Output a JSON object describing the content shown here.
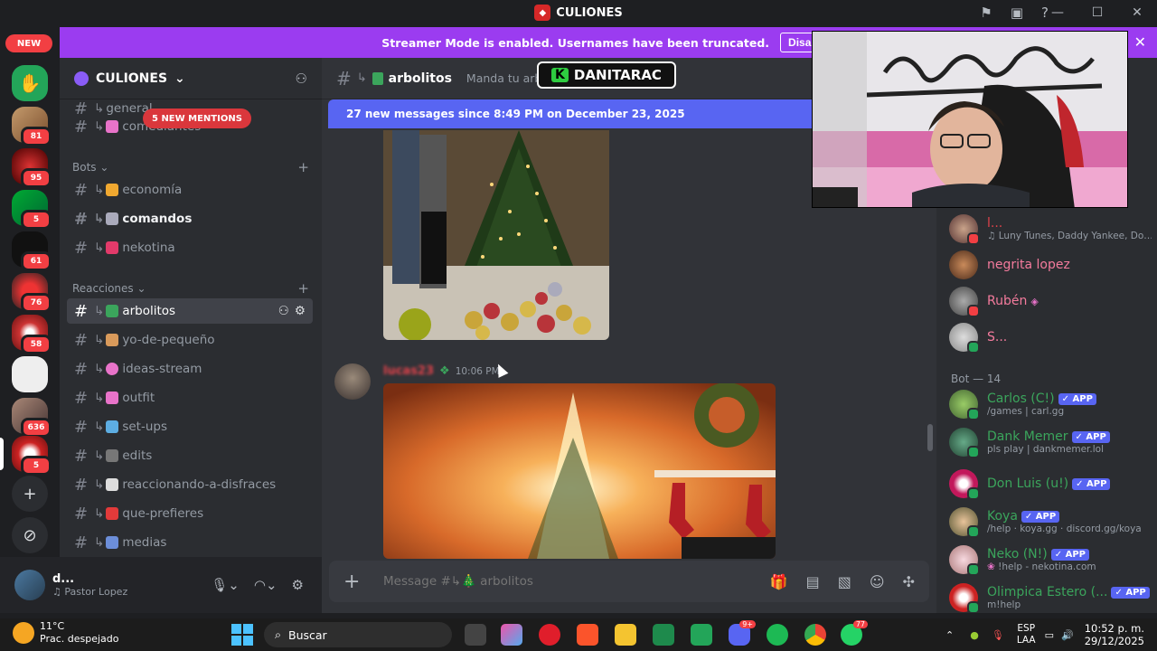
{
  "window": {
    "title": "CULIONES",
    "minimize": "—",
    "maximize": "☐",
    "close": "✕"
  },
  "banner": {
    "text": "Streamer Mode is enabled. Usernames have been truncated.",
    "disable": "Disable",
    "close": "✕"
  },
  "rail": {
    "new_label": "NEW",
    "badges": [
      "81",
      "95",
      "5",
      "61",
      "76",
      "58",
      "636",
      "5"
    ],
    "add": "+",
    "discover": "⊘"
  },
  "server": {
    "name": "CULIONES",
    "chevron": "⌄"
  },
  "sidebar": {
    "mentions": "5 NEW MENTIONS",
    "channels_top": [
      {
        "name": "general"
      },
      {
        "name": "comediantes"
      }
    ],
    "cat_bots": "Bots",
    "bots": [
      {
        "name": "economía"
      },
      {
        "name": "comandos"
      },
      {
        "name": "nekotina"
      }
    ],
    "cat_reacciones": "Reacciones",
    "reacciones": [
      {
        "name": "arbolitos"
      },
      {
        "name": "yo-de-pequeño"
      },
      {
        "name": "ideas-stream"
      },
      {
        "name": "outfit"
      },
      {
        "name": "set-ups"
      },
      {
        "name": "edits"
      },
      {
        "name": "reaccionando-a-disfraces"
      },
      {
        "name": "que-prefieres"
      },
      {
        "name": "medias"
      }
    ]
  },
  "user": {
    "name": "d...",
    "status": "Pastor Lopez"
  },
  "chat": {
    "channel": "arbolitos",
    "topic": "Manda tu arb",
    "new_messages": "27 new messages since 8:49 PM on December 23, 2025",
    "author": "lucas23",
    "time": "10:06 PM",
    "placeholder": "Message #↳🎄 arbolitos"
  },
  "overlay": {
    "k": "K",
    "text": "DANITARAC"
  },
  "members": {
    "online": [
      {
        "name": "l...",
        "sub": "Luny Tunes, Daddy Yankee, Don O",
        "color": "#e0424a"
      },
      {
        "name": "negrita lopez",
        "sub": "",
        "color": "#f47b9d"
      },
      {
        "name": "Rubén",
        "sub": "",
        "color": "#f47b9d"
      },
      {
        "name": "S...",
        "sub": "",
        "color": "#f47b9d"
      }
    ],
    "bot_header": "Bot — 14",
    "bots": [
      {
        "name": "Carlos (C!)",
        "sub": "/games | carl.gg",
        "app": "APP"
      },
      {
        "name": "Dank Memer",
        "sub": "pls play | dankmemer.lol",
        "app": "APP"
      },
      {
        "name": "Don Luis (u!)",
        "sub": "",
        "app": "APP"
      },
      {
        "name": "Koya",
        "sub": "/help · koya.gg · discord.gg/koya",
        "app": "APP"
      },
      {
        "name": "Neko (N!)",
        "sub": "!help - nekotina.com",
        "app": "APP"
      },
      {
        "name": "Olimpica Estero (...",
        "sub": "m!help",
        "app": "APP"
      }
    ]
  },
  "taskbar": {
    "temp": "11°C",
    "weather": "Prac. despejado",
    "search": "Buscar",
    "discord_badge": "9+",
    "whatsapp_badge": "77",
    "lang1": "ESP",
    "lang2": "LAA",
    "time": "10:52 p. m.",
    "date": "29/12/2025"
  }
}
